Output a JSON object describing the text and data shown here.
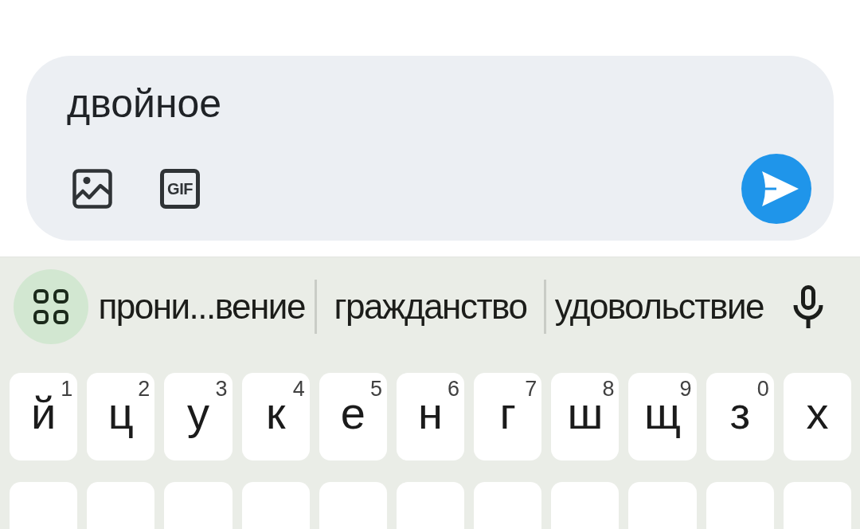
{
  "composer": {
    "text": "двойное",
    "gif_label": "GIF"
  },
  "keyboard": {
    "suggestions": [
      {
        "text": "прони...вение"
      },
      {
        "text": "гражданство"
      },
      {
        "text": "удовольствие"
      }
    ],
    "rows": [
      [
        {
          "kind": "letter",
          "key": "й",
          "hint": "1"
        },
        {
          "kind": "letter",
          "key": "ц",
          "hint": "2"
        },
        {
          "kind": "letter",
          "key": "у",
          "hint": "3"
        },
        {
          "kind": "letter",
          "key": "к",
          "hint": "4"
        },
        {
          "kind": "letter",
          "key": "е",
          "hint": "5"
        },
        {
          "kind": "letter",
          "key": "н",
          "hint": "6"
        },
        {
          "kind": "letter",
          "key": "г",
          "hint": "7"
        },
        {
          "kind": "letter",
          "key": "ш",
          "hint": "8"
        },
        {
          "kind": "letter",
          "key": "щ",
          "hint": "9"
        },
        {
          "kind": "letter",
          "key": "з",
          "hint": "0"
        },
        {
          "kind": "letter",
          "key": "х"
        }
      ],
      [
        {
          "kind": "blank"
        },
        {
          "kind": "blank"
        },
        {
          "kind": "blank"
        },
        {
          "kind": "blank"
        },
        {
          "kind": "blank"
        },
        {
          "kind": "blank"
        },
        {
          "kind": "blank"
        },
        {
          "kind": "blank"
        },
        {
          "kind": "blank"
        },
        {
          "kind": "blank"
        },
        {
          "kind": "blank"
        }
      ]
    ]
  }
}
